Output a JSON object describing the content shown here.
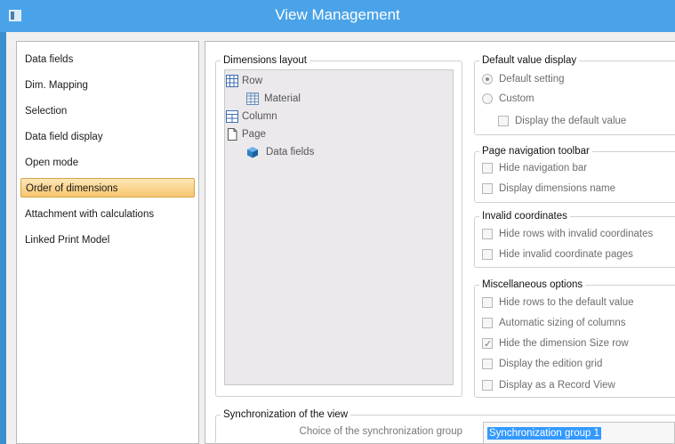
{
  "window": {
    "title": "View Management"
  },
  "nav": {
    "items": [
      {
        "label": "Data fields",
        "selected": false
      },
      {
        "label": "Dim. Mapping",
        "selected": false
      },
      {
        "label": "Selection",
        "selected": false
      },
      {
        "label": "Data field display",
        "selected": false
      },
      {
        "label": "Open mode",
        "selected": false
      },
      {
        "label": "Order of dimensions",
        "selected": true
      },
      {
        "label": "Attachment with calculations",
        "selected": false
      },
      {
        "label": "Linked Print Model",
        "selected": false
      }
    ]
  },
  "dimensions_layout": {
    "title": "Dimensions layout",
    "tree": [
      {
        "label": "Row",
        "icon": "row-grid-icon"
      },
      {
        "label": "Material",
        "icon": "table-icon"
      },
      {
        "label": "Column",
        "icon": "column-grid-icon"
      },
      {
        "label": "Page",
        "icon": "page-icon"
      },
      {
        "label": "Data fields",
        "icon": "cube-icon"
      }
    ]
  },
  "default_value_display": {
    "title": "Default value display",
    "options": [
      {
        "label": "Default setting",
        "checked": true
      },
      {
        "label": "Custom",
        "checked": false
      }
    ],
    "display_default": {
      "label": "Display the default value",
      "checked": false
    }
  },
  "page_navigation": {
    "title": "Page navigation toolbar",
    "options": [
      {
        "label": "Hide navigation bar",
        "checked": false
      },
      {
        "label": "Display dimensions name",
        "checked": false
      }
    ]
  },
  "invalid_coordinates": {
    "title": "Invalid coordinates",
    "options": [
      {
        "label": "Hide rows with invalid coordinates",
        "checked": false
      },
      {
        "label": "Hide invalid coordinate pages",
        "checked": false
      }
    ]
  },
  "miscellaneous": {
    "title": "Miscellaneous options",
    "options": [
      {
        "label": "Hide rows to the default value",
        "checked": false
      },
      {
        "label": "Automatic sizing of columns",
        "checked": false
      },
      {
        "label": "Hide the dimension Size row",
        "checked": true
      },
      {
        "label": "Display the edition grid",
        "checked": false
      },
      {
        "label": "Display as a Record View",
        "checked": false
      }
    ]
  },
  "synchronization": {
    "title": "Synchronization of the view",
    "label": "Choice of the synchronization group",
    "value": "Synchronization group 1"
  },
  "colors": {
    "titlebar": "#4aa3e8",
    "selected_nav": "#f7c56c",
    "selection_highlight": "#3399ff"
  }
}
